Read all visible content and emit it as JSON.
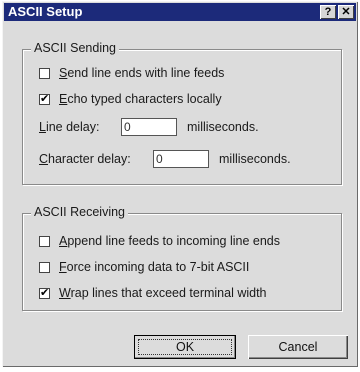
{
  "window": {
    "title": "ASCII Setup"
  },
  "titlebar": {
    "help_label": "?",
    "close_label": "✕"
  },
  "sending": {
    "title": "ASCII Sending",
    "send_line_ends": {
      "prefix": "",
      "key": "S",
      "rest": "end line ends with line feeds",
      "checked": false
    },
    "echo": {
      "prefix": "",
      "key": "E",
      "rest": "cho typed characters locally",
      "checked": true
    },
    "line_delay": {
      "key": "L",
      "rest": "ine delay:",
      "value": "0",
      "unit": "milliseconds."
    },
    "char_delay": {
      "key": "C",
      "rest": "haracter delay:",
      "value": "0",
      "unit": "milliseconds."
    }
  },
  "receiving": {
    "title": "ASCII Receiving",
    "append": {
      "key": "A",
      "rest": "ppend line feeds to incoming line ends",
      "checked": false
    },
    "force": {
      "key": "F",
      "rest": "orce incoming data to 7-bit ASCII",
      "checked": false
    },
    "wrap": {
      "key": "W",
      "rest": "rap lines that exceed terminal width",
      "checked": true
    }
  },
  "buttons": {
    "ok": "OK",
    "cancel": "Cancel"
  },
  "check_glyph": "✔"
}
